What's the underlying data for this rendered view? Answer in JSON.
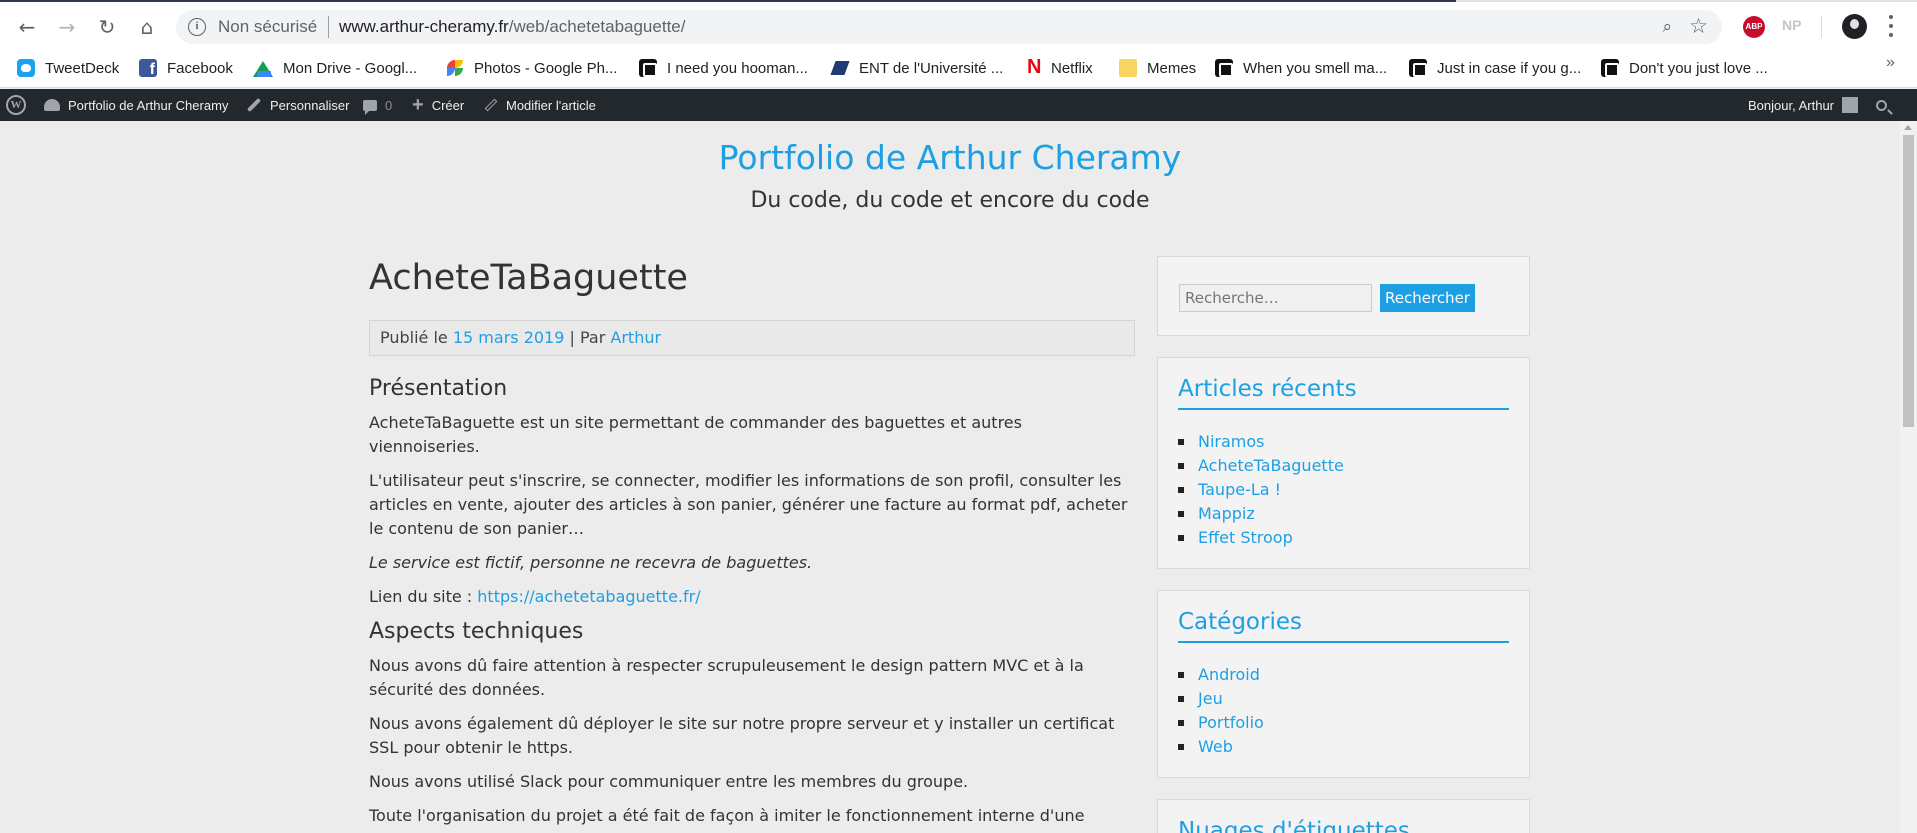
{
  "browser": {
    "security_label": "Non sécurisé",
    "url_host": "www.arthur-cheramy.fr",
    "url_path": "/web/achetetabaguette/",
    "extensions": {
      "abp": "ABP",
      "np": "NP"
    }
  },
  "bookmarks": [
    {
      "label": "TweetDeck",
      "icon": "twitter-icon"
    },
    {
      "label": "Facebook",
      "icon": "facebook-icon"
    },
    {
      "label": "Mon Drive - Googl...",
      "icon": "google-drive-icon"
    },
    {
      "label": "Photos - Google Ph...",
      "icon": "google-photos-icon"
    },
    {
      "label": "I need you hooman...",
      "icon": "imgur-icon"
    },
    {
      "label": "ENT de l'Université ...",
      "icon": "ent-icon"
    },
    {
      "label": "Netflix",
      "icon": "netflix-icon"
    },
    {
      "label": "Memes",
      "icon": "folder-icon"
    },
    {
      "label": "When you smell ma...",
      "icon": "imgur-icon"
    },
    {
      "label": "Just in case if you g...",
      "icon": "imgur-icon"
    },
    {
      "label": "Don't you just love ...",
      "icon": "imgur-icon"
    }
  ],
  "bookmarks_overflow": "»",
  "adminbar": {
    "site_name": "Portfolio de Arthur Cheramy",
    "customize": "Personnaliser",
    "comments_count": "0",
    "new": "Créer",
    "edit": "Modifier l'article",
    "greeting": "Bonjour, Arthur"
  },
  "site": {
    "title": "Portfolio de Arthur Cheramy",
    "description": "Du code, du code et encore du code"
  },
  "article": {
    "title": "AcheteTaBaguette",
    "meta_prefix": "Publié le ",
    "date": "15 mars 2019",
    "meta_by": " | Par ",
    "author": "Arthur",
    "section1_title": "Présentation",
    "p1": "AcheteTaBaguette est un site permettant de commander des baguettes et autres viennoiseries.",
    "p2": "L'utilisateur peut s'inscrire, se connecter, modifier les informations de son profil, consulter les articles en vente, ajouter des articles à son panier, générer une facture au format pdf, acheter le contenu de son panier…",
    "p3": "Le service est fictif, personne ne recevra de baguettes.",
    "link_prefix": "Lien du site : ",
    "link": "https://achetetabaguette.fr/",
    "section2_title": "Aspects techniques",
    "p4": "Nous avons dû faire attention à respecter scrupuleusement le design pattern MVC et à la sécurité des données.",
    "p5": "Nous avons également dû déployer le site sur notre propre serveur et y installer un certificat SSL pour obtenir le https.",
    "p6": "Nous avons utilisé Slack pour communiquer entre les membres du groupe.",
    "p7": "Toute l'organisation du projet a été fait de façon à imiter le fonctionnement interne d'une entreprise."
  },
  "sidebar": {
    "search_placeholder": "Recherche…",
    "search_button": "Rechercher",
    "recent_title": "Articles récents",
    "recent": [
      "Niramos",
      "AcheteTaBaguette",
      "Taupe-La !",
      "Mappiz",
      "Effet Stroop"
    ],
    "categories_title": "Catégories",
    "categories": [
      "Android",
      "Jeu",
      "Portfolio",
      "Web"
    ],
    "tags_title": "Nuages d'étiquettes"
  }
}
